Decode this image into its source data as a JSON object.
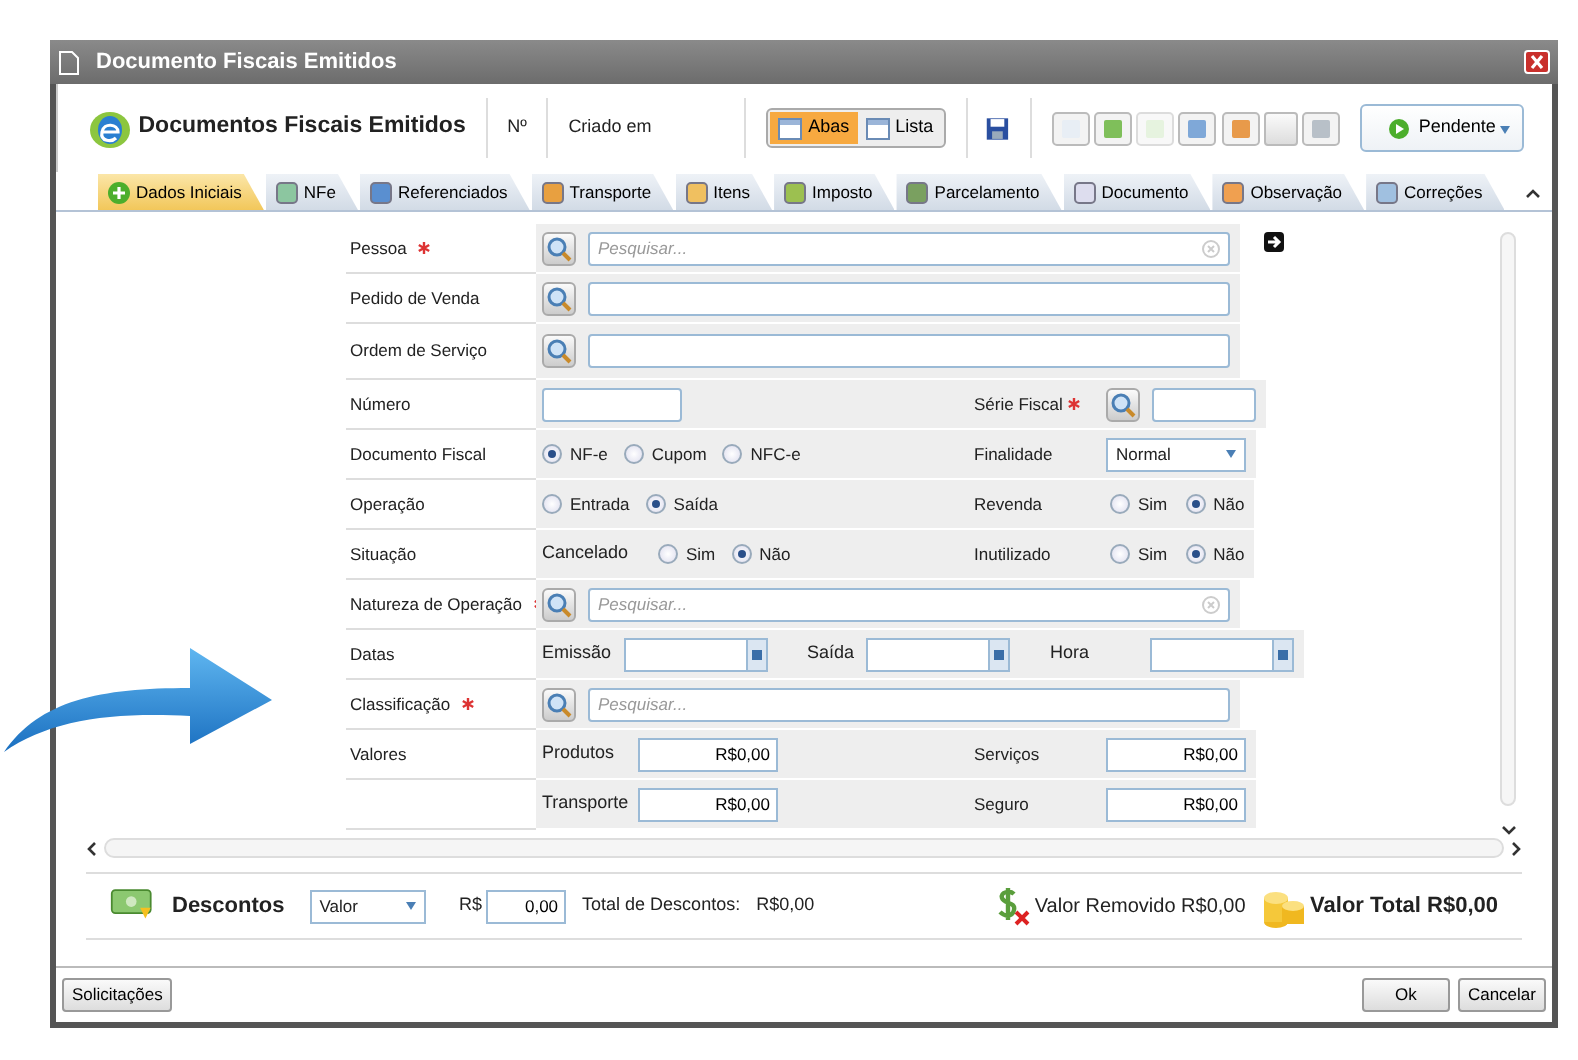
{
  "window": {
    "title": "Documento Fiscais Emitidos"
  },
  "header": {
    "title": "Documentos Fiscais Emitidos",
    "number_label": "Nº",
    "created_label": "Criado em",
    "view_options": [
      {
        "label": "Abas",
        "selected": true
      },
      {
        "label": "Lista",
        "selected": false
      }
    ],
    "status_button": "Pendente"
  },
  "tabs": [
    {
      "label": "Dados Iniciais",
      "selected": true
    },
    {
      "label": "NFe",
      "selected": false
    },
    {
      "label": "Referenciados",
      "selected": false
    },
    {
      "label": "Transporte",
      "selected": false
    },
    {
      "label": "Itens",
      "selected": false
    },
    {
      "label": "Imposto",
      "selected": false
    },
    {
      "label": "Parcelamento",
      "selected": false
    },
    {
      "label": "Documento",
      "selected": false
    },
    {
      "label": "Observação",
      "selected": false
    },
    {
      "label": "Correções",
      "selected": false
    }
  ],
  "form": {
    "rows": [
      {
        "kind": "search",
        "label": "Pessoa",
        "required": true,
        "placeholder": "Pesquisar...",
        "clear_icon": true
      },
      {
        "kind": "search",
        "label": "Pedido de Venda",
        "required": false
      },
      {
        "kind": "search",
        "label": "Ordem de Serviço",
        "required": false
      },
      {
        "kind": "number",
        "label": "Número",
        "right": {
          "kind": "search",
          "label": "Série Fiscal",
          "required": true
        }
      },
      {
        "kind": "radios",
        "label": "Documento Fiscal",
        "options": [
          {
            "label": "NF-e",
            "selected": true
          },
          {
            "label": "Cupom",
            "selected": false
          },
          {
            "label": "NFC-e",
            "selected": false
          }
        ],
        "right": {
          "kind": "select",
          "label": "Finalidade",
          "value": "Normal"
        }
      },
      {
        "kind": "radios",
        "label": "Operação",
        "options": [
          {
            "label": "Entrada",
            "selected": false
          },
          {
            "label": "Saída",
            "selected": true
          }
        ],
        "right": {
          "kind": "radios",
          "label": "Revenda",
          "options": [
            {
              "label": "Sim",
              "selected": false
            },
            {
              "label": "Não",
              "selected": true
            }
          ]
        }
      },
      {
        "kind": "radios",
        "label": "Situação",
        "sublabel": "Cancelado",
        "options": [
          {
            "label": "Sim",
            "selected": false
          },
          {
            "label": "Não",
            "selected": true
          }
        ],
        "right": {
          "kind": "radios",
          "label": "Inutilizado",
          "options": [
            {
              "label": "Sim",
              "selected": false
            },
            {
              "label": "Não",
              "selected": true
            }
          ]
        }
      },
      {
        "kind": "search",
        "label": "Natureza de Operação",
        "required": true,
        "placeholder": "Pesquisar...",
        "clear_icon": true
      },
      {
        "kind": "dates",
        "label": "Datas",
        "fields": [
          "Emissão",
          "Saída",
          "Hora"
        ]
      },
      {
        "kind": "search",
        "label": "Classificação",
        "required": true,
        "placeholder": "Pesquisar...",
        "clear_icon": false
      },
      {
        "kind": "money",
        "label": "Valores",
        "left": {
          "label": "Produtos",
          "value": "R$0,00"
        },
        "right": {
          "label": "Serviços",
          "value": "R$0,00"
        }
      },
      {
        "kind": "money",
        "left": {
          "label": "Transporte",
          "value": "R$0,00"
        },
        "right": {
          "label": "Seguro",
          "value": "R$0,00"
        }
      }
    ]
  },
  "discounts": {
    "label": "Descontos",
    "type_select": "Valor",
    "currency": "R$",
    "amount": "0,00",
    "total_label": "Total de Descontos:",
    "total_value": "R$0,00"
  },
  "removed": "Valor Removido R$0,00",
  "total": "Valor Total R$0,00",
  "buttons": {
    "left": [
      "Solicitações"
    ],
    "right": [
      "Ok",
      "Cancelar"
    ]
  }
}
